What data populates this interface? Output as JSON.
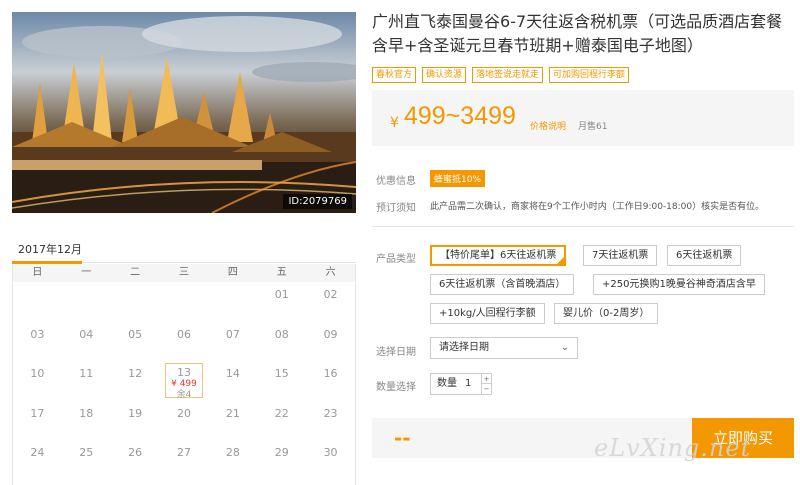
{
  "hero": {
    "image_id": "ID:2079769"
  },
  "calendar": {
    "month": "2017年12月",
    "weekdays": [
      "日",
      "一",
      "二",
      "三",
      "四",
      "五",
      "六"
    ],
    "weeks": [
      [
        "",
        "",
        "",
        "",
        "",
        "01",
        "02"
      ],
      [
        "03",
        "04",
        "05",
        "06",
        "07",
        "08",
        "09"
      ],
      [
        "10",
        "11",
        "12",
        "13",
        "14",
        "15",
        "16"
      ],
      [
        "17",
        "18",
        "19",
        "20",
        "21",
        "22",
        "23"
      ],
      [
        "24",
        "25",
        "26",
        "27",
        "28",
        "29",
        "30"
      ]
    ],
    "special": {
      "day": "13",
      "price": "¥ 499",
      "stock": "余4"
    }
  },
  "product": {
    "title": "广州直飞泰国曼谷6-7天往返含税机票（可选品质酒店套餐含早+含圣诞元旦春节班期+赠泰国电子地图）",
    "tags": [
      "春秋官方",
      "确认资源",
      "落地签说走就走",
      "可加购回程行李额"
    ],
    "price": {
      "currency": "¥",
      "range": "499~3499",
      "note": "价格说明",
      "sold": "月售61"
    },
    "discount_label": "优惠信息",
    "coupon": "蜂蜜抵10%",
    "notice_label": "预订须知",
    "notice": "此产品需二次确认，商家将在9个工作小时内（工作日9:00-18:00）核实是否有位。",
    "type_label": "产品类型",
    "options": [
      "【特价尾单】6天往返机票",
      "7天往返机票",
      "6天往返机票",
      "6天往返机票（含首晚酒店）",
      "+250元换购1晚曼谷神奇酒店含早",
      "+10kg/人回程行李额",
      "婴儿价（0-2周岁）"
    ],
    "date_label": "选择日期",
    "date_placeholder": "请选择日期",
    "qty_label": "数量选择",
    "qty_text": "数量",
    "qty_value": "1",
    "total": "--",
    "buy_label": "立即购买"
  },
  "watermark": "eLvXing.net",
  "colors": {
    "accent": "#f39800",
    "price_red": "#e4393c"
  }
}
